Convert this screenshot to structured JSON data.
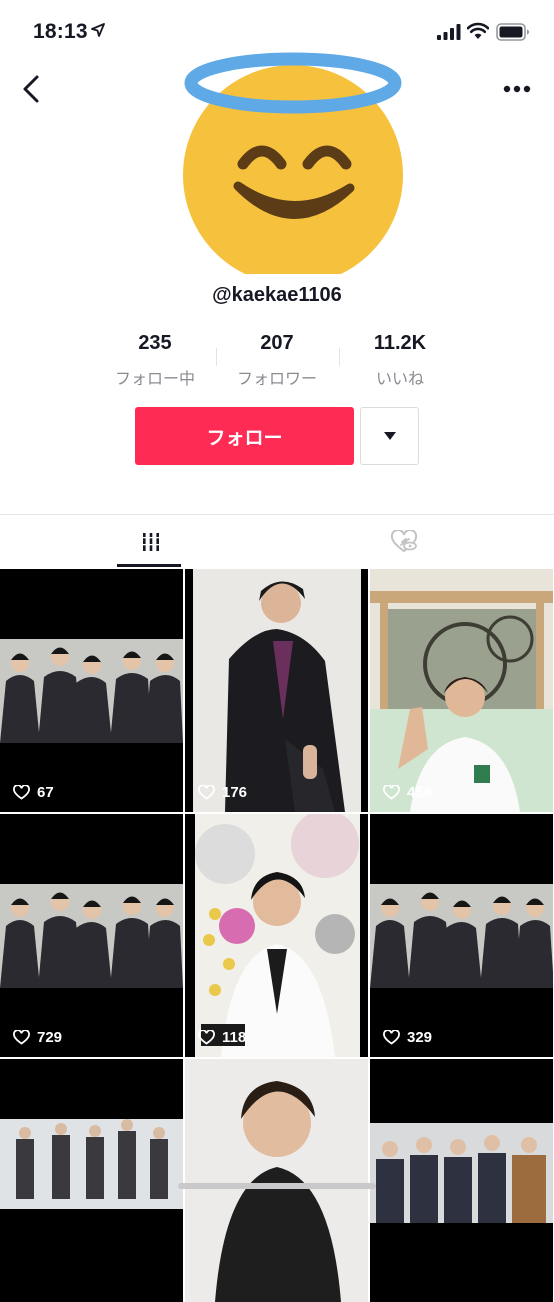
{
  "status_bar": {
    "time": "18:13"
  },
  "profile": {
    "username": "@kaekae1106",
    "avatar_icon": "smiling-face-with-halo-icon"
  },
  "stats": [
    {
      "value": "235",
      "label": "フォロー中"
    },
    {
      "value": "207",
      "label": "フォロワー"
    },
    {
      "value": "11.2K",
      "label": "いいね"
    }
  ],
  "actions": {
    "follow_label": "フォロー",
    "dropdown_icon": "caret-down-icon"
  },
  "tabs": [
    {
      "name": "videos",
      "icon": "grid-icon",
      "active": true
    },
    {
      "name": "liked",
      "icon": "hidden-heart-icon",
      "active": false
    }
  ],
  "videos": [
    {
      "likes": "67"
    },
    {
      "likes": "176"
    },
    {
      "likes": "458"
    },
    {
      "likes": "729"
    },
    {
      "likes": "118"
    },
    {
      "likes": "329"
    },
    {
      "likes": ""
    },
    {
      "likes": ""
    },
    {
      "likes": ""
    }
  ],
  "colors": {
    "accent": "#fe2c55",
    "text": "#161823",
    "muted": "#8a8b91"
  }
}
